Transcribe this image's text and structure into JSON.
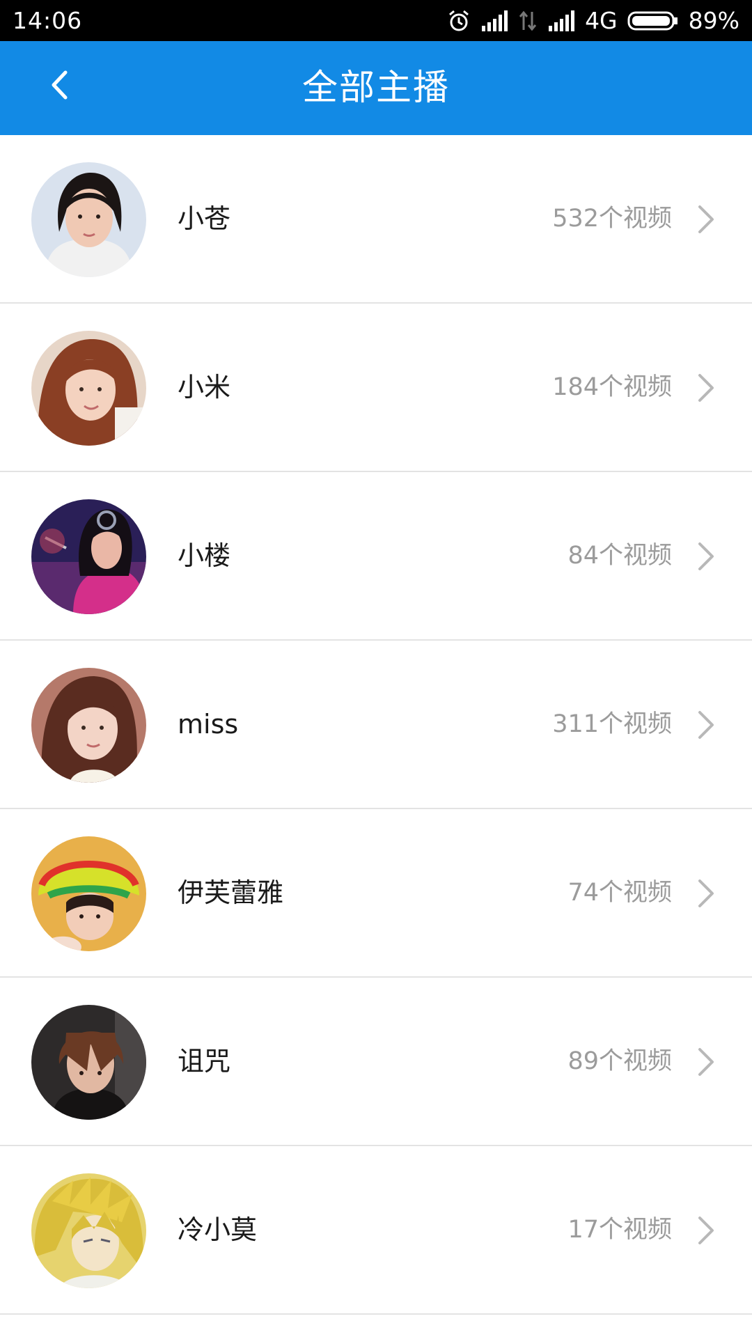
{
  "status_bar": {
    "time": "14:06",
    "network": "4G",
    "battery": "89%",
    "icons": [
      "alarm-icon",
      "signal-icon",
      "data-arrows-icon",
      "signal-icon",
      "battery-icon"
    ]
  },
  "app_bar": {
    "title": "全部主播",
    "back_icon": "chevron-left-icon"
  },
  "anchors": [
    {
      "name": "小苍",
      "videos": "532个视频"
    },
    {
      "name": "小米",
      "videos": "184个视频"
    },
    {
      "name": "小楼",
      "videos": "84个视频"
    },
    {
      "name": "miss",
      "videos": "311个视频"
    },
    {
      "name": "伊芙蕾雅",
      "videos": "74个视频"
    },
    {
      "name": "诅咒",
      "videos": "89个视频"
    },
    {
      "name": "冷小莫",
      "videos": "17个视频"
    }
  ],
  "colors": {
    "app_bar": "#128ae5",
    "status_bar": "#000000",
    "secondary_text": "#9b9b9b",
    "divider": "#e3e3e3"
  }
}
